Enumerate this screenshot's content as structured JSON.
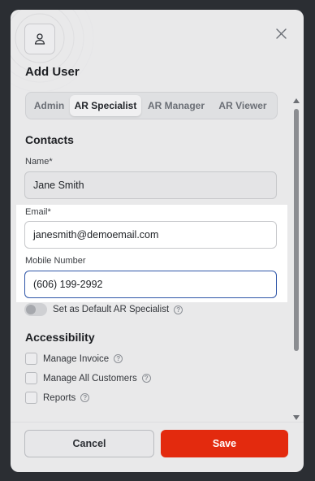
{
  "modal": {
    "title": "Add User",
    "close_icon": "close-icon",
    "avatar_icon": "user-icon"
  },
  "tabs": [
    {
      "label": "Admin",
      "active": false
    },
    {
      "label": "AR Specialist",
      "active": true
    },
    {
      "label": "AR Manager",
      "active": false
    },
    {
      "label": "AR Viewer",
      "active": false
    }
  ],
  "contacts": {
    "section_title": "Contacts",
    "name_label": "Name*",
    "name_value": "Jane Smith",
    "email_label": "Email*",
    "email_value": "janesmith@demoemail.com",
    "mobile_label": "Mobile Number",
    "mobile_value": "(606) 199-2992",
    "default_toggle_label": "Set as Default AR Specialist",
    "default_toggle_on": false
  },
  "accessibility": {
    "section_title": "Accessibility",
    "items": [
      {
        "label": "Manage Invoice",
        "checked": false
      },
      {
        "label": "Manage All Customers",
        "checked": false
      },
      {
        "label": "Reports",
        "checked": false
      }
    ]
  },
  "footer": {
    "cancel_label": "Cancel",
    "save_label": "Save"
  },
  "colors": {
    "save_button": "#e32a0e",
    "focus_border": "#2f56a8",
    "highlight": "#ffffff"
  },
  "help_glyph": "?"
}
